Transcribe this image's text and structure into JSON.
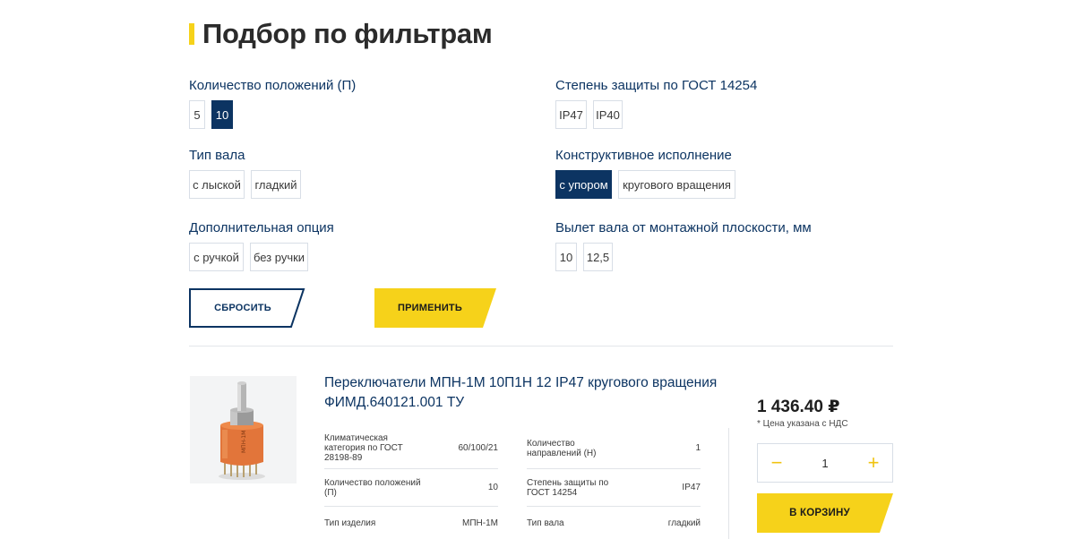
{
  "page": {
    "title": "Подбор по фильтрам"
  },
  "filters": {
    "positions": {
      "label": "Количество положений (П)",
      "options": [
        "5",
        "10"
      ],
      "active": "10"
    },
    "protection": {
      "label": "Степень защиты по ГОСТ 14254",
      "options": [
        "IP47",
        "IP40"
      ],
      "active": ""
    },
    "shaft_type": {
      "label": "Тип вала",
      "options": [
        "с лыской",
        "гладкий"
      ],
      "active": ""
    },
    "design": {
      "label": "Конструктивное исполнение",
      "options": [
        "с упором",
        "кругового вращения"
      ],
      "active": "с упором"
    },
    "extra_option": {
      "label": "Дополнительная опция",
      "options": [
        "с ручкой",
        "без ручки"
      ],
      "active": ""
    },
    "shaft_offset": {
      "label": "Вылет вала от монтажной плоскости, мм",
      "options": [
        "10",
        "12,5"
      ],
      "active": ""
    }
  },
  "actions": {
    "reset_label": "СБРОСИТЬ",
    "apply_label": "ПРИМЕНИТЬ"
  },
  "product": {
    "title": "Переключатели МПН-1М 10П1Н 12 IP47 кругового вращения ФИМД.640121.001 ТУ",
    "specs_left": [
      {
        "name": "Климатическая категория по ГОСТ 28198-89",
        "value": "60/100/21"
      },
      {
        "name": "Количество положений (П)",
        "value": "10"
      },
      {
        "name": "Тип изделия",
        "value": "МПН-1М"
      }
    ],
    "specs_right": [
      {
        "name": "Количество направлений (Н)",
        "value": "1"
      },
      {
        "name": "Степень защиты по ГОСТ 14254",
        "value": "IP47"
      },
      {
        "name": "Тип вала",
        "value": "гладкий"
      }
    ],
    "price": "1 436.40 ₽",
    "price_note": "* Цена указана с НДС",
    "quantity": "1",
    "minus_symbol": "−",
    "plus_symbol": "+",
    "cart_label": "В КОРЗИНУ",
    "image_icon": "rotary-switch-photo"
  },
  "colors": {
    "brand_navy": "#0c3462",
    "accent_yellow": "#f6d21a"
  }
}
